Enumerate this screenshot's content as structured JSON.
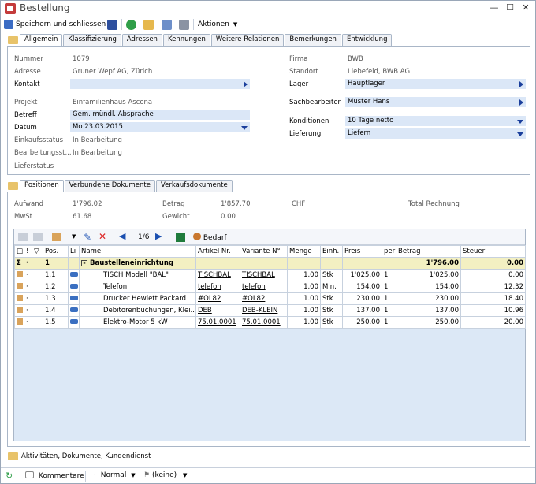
{
  "window": {
    "title": "Bestellung"
  },
  "toolbar": {
    "save_close": "Speichern und schliessen",
    "actions": "Aktionen"
  },
  "tabs_top": [
    "Allgemein",
    "Klassifizierung",
    "Adressen",
    "Kennungen",
    "Weitere Relationen",
    "Bemerkungen",
    "Entwicklung"
  ],
  "general": {
    "nummer_label": "Nummer",
    "nummer": "1079",
    "adresse_label": "Adresse",
    "adresse": "Gruner Wepf AG, Zürich",
    "kontakt_label": "Kontakt",
    "kontakt": "",
    "projekt_label": "Projekt",
    "projekt": "Einfamilienhaus Ascona",
    "betreff_label": "Betreff",
    "betreff": "Gem. mündl. Absprache",
    "datum_label": "Datum",
    "datum": "Mo 23.03.2015",
    "einkaufsstatus_label": "Einkaufsstatus",
    "einkaufsstatus": "In Bearbeitung",
    "bearbeitungsstatus_label": "Bearbeitungsst...",
    "bearbeitungsstatus": "In Bearbeitung",
    "lieferstatus_label": "Lieferstatus",
    "firma_label": "Firma",
    "firma": "BWB",
    "standort_label": "Standort",
    "standort": "Liebefeld, BWB AG",
    "lager_label": "Lager",
    "lager": "Hauptlager",
    "sachbearbeiter_label": "Sachbearbeiter",
    "sachbearbeiter": "Muster Hans",
    "konditionen_label": "Konditionen",
    "konditionen": "10 Tage netto",
    "lieferung_label": "Lieferung",
    "lieferung": "Liefern"
  },
  "tabs_bottom": [
    "Positionen",
    "Verbundene Dokumente",
    "Verkaufsdokumente"
  ],
  "summary": {
    "aufwand_label": "Aufwand",
    "aufwand": "1'796.02",
    "betrag_label": "Betrag",
    "betrag": "1'857.70",
    "currency": "CHF",
    "total_label": "Total Rechnung",
    "mwst_label": "MwSt",
    "mwst": "61.68",
    "gewicht_label": "Gewicht",
    "gewicht": "0.00"
  },
  "grid_toolbar": {
    "pager": "1/6",
    "bedarf": "Bedarf"
  },
  "columns": [
    "Pos.",
    "Li",
    "Name",
    "Artikel Nr.",
    "Variante N°",
    "Menge",
    "Einh.",
    "Preis",
    "per",
    "Betrag",
    "Steuer"
  ],
  "group": {
    "pos": "1",
    "name": "Baustelleneinrichtung",
    "betrag": "1'796.00",
    "steuer": "0.00"
  },
  "rows": [
    {
      "dot": "·",
      "pos": "1.1",
      "name": "TISCH Modell \"BAL\"",
      "artikel": "TISCHBAL",
      "variante": "TISCHBAL",
      "menge": "1.00",
      "einh": "Stk",
      "preis": "1'025.00",
      "per": "1",
      "betrag": "1'025.00",
      "steuer": "0.00"
    },
    {
      "dot": "·",
      "pos": "1.2",
      "name": "Telefon",
      "artikel": "telefon",
      "variante": "telefon",
      "menge": "1.00",
      "einh": "Min.",
      "preis": "154.00",
      "per": "1",
      "betrag": "154.00",
      "steuer": "12.32"
    },
    {
      "dot": "·",
      "pos": "1.3",
      "name": "Drucker Hewlett Packard",
      "artikel": "#OL82",
      "variante": "#OL82",
      "menge": "1.00",
      "einh": "Stk",
      "preis": "230.00",
      "per": "1",
      "betrag": "230.00",
      "steuer": "18.40"
    },
    {
      "dot": "·",
      "pos": "1.4",
      "name": "Debitorenbuchungen, Klei...",
      "artikel": "DEB",
      "variante": "DEB-KLEIN",
      "menge": "1.00",
      "einh": "Stk",
      "preis": "137.00",
      "per": "1",
      "betrag": "137.00",
      "steuer": "10.96"
    },
    {
      "dot": "·",
      "pos": "1.5",
      "name": "Elektro-Motor 5 kW",
      "artikel": "75.01.0001",
      "variante": "75.01.0001",
      "menge": "1.00",
      "einh": "Stk",
      "preis": "250.00",
      "per": "1",
      "betrag": "250.00",
      "steuer": "20.00"
    }
  ],
  "footer_section": "Aktivitäten, Dokumente, Kundendienst",
  "statusbar": {
    "kommentare": "Kommentare",
    "priority": "Normal",
    "flag": "(keine)"
  }
}
